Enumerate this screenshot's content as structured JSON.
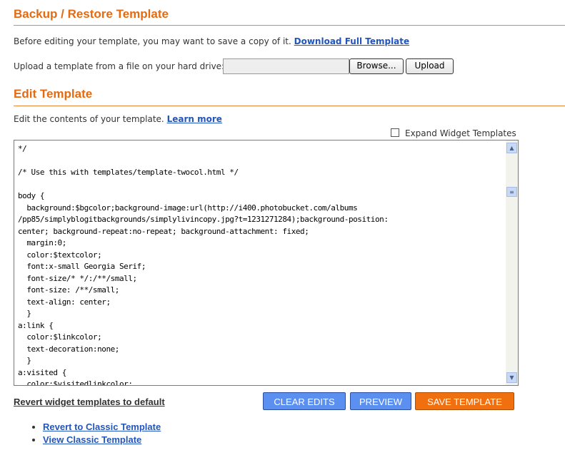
{
  "backup": {
    "title": "Backup / Restore Template",
    "intro": "Before editing your template, you may want to save a copy of it.",
    "download_link": "Download Full Template",
    "upload_label": "Upload a template from a file on your hard drive:",
    "file_value": "",
    "browse_label": "Browse...",
    "upload_button": "Upload"
  },
  "edit": {
    "title": "Edit Template",
    "intro": "Edit the contents of your template.",
    "learn_more": "Learn more",
    "expand_label": "Expand Widget Templates",
    "expand_checked": false,
    "code": "*/\n\n/* Use this with templates/template-twocol.html */\n\nbody {\n  background:$bgcolor;background-image:url(http://i400.photobucket.com/albums\n/pp85/simplyblogitbackgrounds/simplylivincopy.jpg?t=1231271284);background-position:\ncenter; background-repeat:no-repeat; background-attachment: fixed;\n  margin:0;\n  color:$textcolor;\n  font:x-small Georgia Serif;\n  font-size/* */:/**/small;\n  font-size: /**/small;\n  text-align: center;\n  }\na:link {\n  color:$linkcolor;\n  text-decoration:none;\n  }\na:visited {\n  color:$visitedlinkcolor;"
  },
  "actions": {
    "revert_widgets": "Revert widget templates to default",
    "clear_edits": "CLEAR EDITS",
    "preview": "PREVIEW",
    "save": "SAVE TEMPLATE",
    "blue": "#5b8ff0",
    "orange": "#f07010"
  },
  "links": [
    {
      "label": "Revert to Classic Template"
    },
    {
      "label": "View Classic Template"
    }
  ]
}
